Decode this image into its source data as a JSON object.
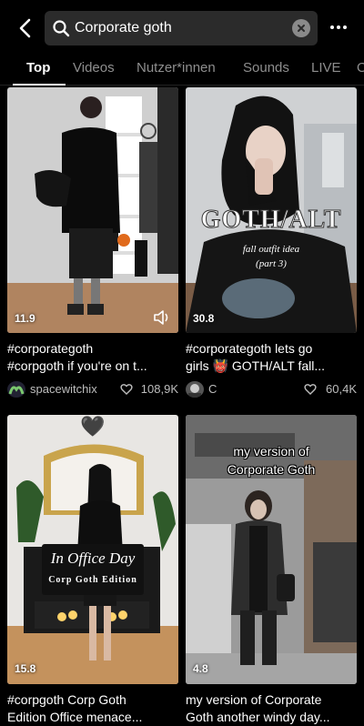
{
  "search": {
    "query": "Corporate goth"
  },
  "tabs": [
    {
      "label": "Top"
    },
    {
      "label": "Videos"
    },
    {
      "label": "Nutzer*innen"
    },
    {
      "label": "Sounds"
    },
    {
      "label": "LIVE"
    },
    {
      "label": "O"
    }
  ],
  "results": [
    {
      "views": "11.9",
      "caption1": "#corporategoth",
      "caption2": "#corpgoth if you're on t...",
      "username": "spacewitchix",
      "likes": "108,9K"
    },
    {
      "views": "30.8",
      "overlay_title": "GOTH/ALT",
      "overlay_sub1": "fall outfit idea",
      "overlay_sub2": "(part 3)",
      "caption1": "#corporategoth lets go",
      "caption2": "girls 👹 GOTH/ALT fall...",
      "username": "C",
      "likes": "60,4K"
    },
    {
      "views": "15.8",
      "overlay_title": "In Office Day",
      "overlay_sub1": "Corp Goth Edition",
      "overlay_emoji": "🖤",
      "caption1": "#corpgoth Corp Goth",
      "caption2": "Edition Office menace..."
    },
    {
      "views": "4.8",
      "overlay_title1": "my version of",
      "overlay_title2": "Corporate Goth",
      "caption1": "my version of Corporate",
      "caption2": "Goth another windy day..."
    }
  ],
  "colors": {
    "background": "#000000",
    "search_bg": "#2b2b2b",
    "tab_inactive": "#8e8e8e"
  }
}
